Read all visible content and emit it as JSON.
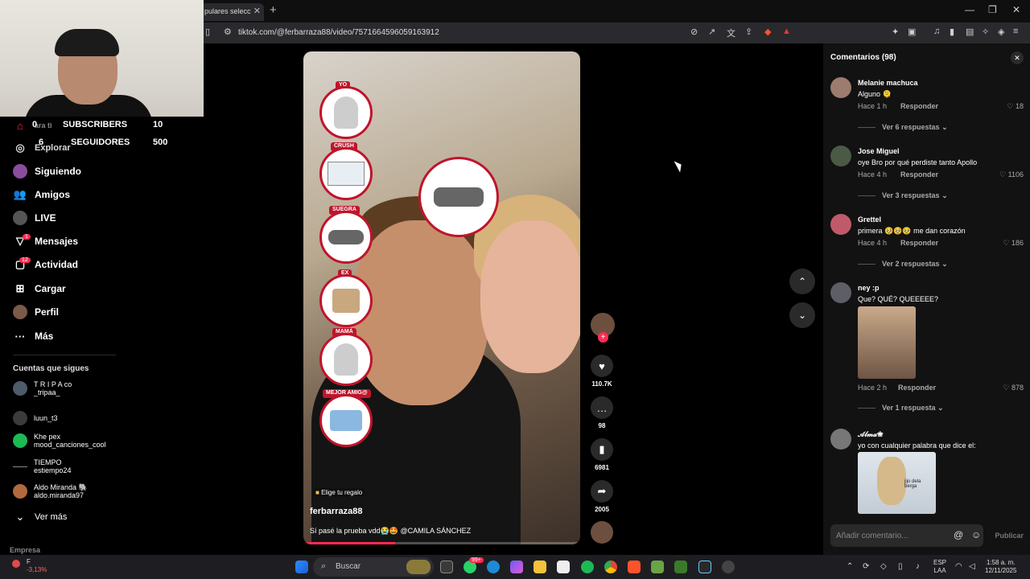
{
  "browser": {
    "tab_title": "pulares selecc",
    "tab_close": "✕",
    "new_tab": "+",
    "url": "tiktok.com/@ferbarraza88/video/7571664596059163912",
    "window_controls": [
      "—",
      "❐",
      "✕"
    ]
  },
  "stream_overlay": {
    "subscribers_label": "SUBSCRIBERS",
    "subscribers_value": "10",
    "subscribers_left": "0",
    "followers_label": "SEGUIDORES",
    "followers_value": "500",
    "followers_left": "6"
  },
  "sidebar": {
    "faded_text": "ara ti",
    "items": [
      {
        "label": "Explorar",
        "icon": "compass-icon"
      },
      {
        "label": "Siguiendo",
        "icon": "following-avatar-icon"
      },
      {
        "label": "Amigos",
        "icon": "friends-icon"
      },
      {
        "label": "LIVE",
        "icon": "live-icon"
      },
      {
        "label": "Mensajes",
        "icon": "messages-icon",
        "badge": "1"
      },
      {
        "label": "Actividad",
        "icon": "activity-icon",
        "badge": "12"
      },
      {
        "label": "Cargar",
        "icon": "upload-icon"
      },
      {
        "label": "Perfil",
        "icon": "profile-icon"
      },
      {
        "label": "Más",
        "icon": "more-icon"
      }
    ],
    "following_title": "Cuentas que sigues",
    "following": [
      {
        "line1": "T R I P A co",
        "line2": "_tripaa_"
      },
      {
        "line1": "luun_t3",
        "line2": ""
      },
      {
        "line1": "Khe pex",
        "line2": "mood_canciones_cool"
      },
      {
        "line1": "TIEMPO",
        "line2": "estiempo24"
      },
      {
        "line1": "Aldo Miranda 🐘",
        "line2": "aldo.miranda97"
      }
    ],
    "see_more": "Ver más",
    "footer": "Empresa"
  },
  "video": {
    "bubbles": [
      {
        "label": "YO"
      },
      {
        "label": "CRUSH"
      },
      {
        "label": "SUEGRA"
      },
      {
        "label": "EX"
      },
      {
        "label": "MAMÁ"
      },
      {
        "label": "MEJOR AMIG@"
      }
    ],
    "gift_label": "Elige tu regalo",
    "username": "ferbarraza88",
    "description": "Sí pasé la prueba vdd😭🤩 @CAMILA SÁNCHEZ",
    "progress": 0.33
  },
  "actions": {
    "likes": "110.7K",
    "comments": "98",
    "saves": "6981",
    "shares": "2005"
  },
  "comments": {
    "title": "Comentarios (98)",
    "reply_label": "Responder",
    "items": [
      {
        "name": "Melanie machuca",
        "text": "Alguno 🫠",
        "time": "Hace 1 h",
        "likes": "18",
        "more": "Ver 6 respuestas"
      },
      {
        "name": "Jose Miguel",
        "text": "oye Bro por qué perdiste tanto Apollo",
        "time": "Hace 4 h",
        "likes": "1106",
        "more": "Ver 3 respuestas"
      },
      {
        "name": "Grettel",
        "text": "primera 🥹🥹🥹 me dan corazón",
        "time": "Hace 4 h",
        "likes": "186",
        "more": "Ver 2 respuestas"
      },
      {
        "name": "ney :p",
        "text": "Que? QUÉ? QUEEEEE?",
        "time": "Hace 2 h",
        "likes": "878",
        "more": "Ver 1 respuesta"
      },
      {
        "name": "𝒜𝓁𝓂𝒶❀",
        "text": "yo con cualquier palabra que dice el:",
        "time": "",
        "likes": "",
        "more": "",
        "image_caption": "jijo dela berga"
      }
    ],
    "input_placeholder": "Añadir comentario...",
    "post_label": "Publicar"
  },
  "taskbar": {
    "search_label": "Buscar",
    "weather_temp": "F",
    "weather_change": "-3,13%",
    "lang_line1": "ESP",
    "lang_line2": "LAA",
    "time": "1:58 a. m.",
    "date": "12/11/2025",
    "notif_badge": "99+"
  },
  "colors": {
    "accent": "#fe2c55",
    "bubble_border": "#c0142b",
    "panel": "#121212"
  }
}
